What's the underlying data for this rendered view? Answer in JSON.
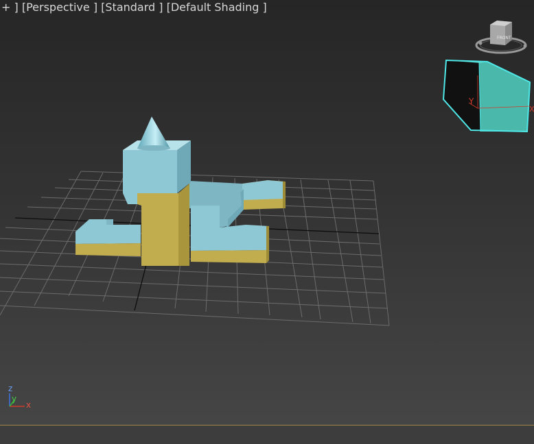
{
  "viewport": {
    "menu_plus": "+ ]",
    "view_label": "[Perspective ]",
    "shading_style": "[Standard ]",
    "shading_mode": "[Default Shading ]"
  },
  "viewcube": {
    "face_label": "FRONT",
    "axis_y": "Y",
    "axis_x": "X"
  },
  "axis_tripod": {
    "z": "z",
    "y": "y",
    "x": "x"
  },
  "colors": {
    "object_top": "#8ec8d4",
    "object_base": "#c2ad4e",
    "selection_outline": "#4fe8e8",
    "grid": "#6c6c6c",
    "axis_x": "#d23b2a",
    "axis_y": "#35b835",
    "axis_z": "#3b74e6"
  }
}
